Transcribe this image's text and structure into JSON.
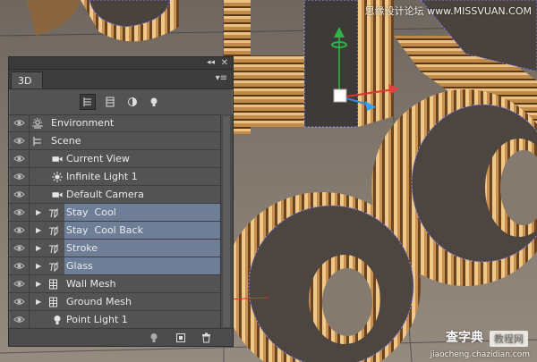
{
  "watermark": {
    "top_right": "思缘设计论坛  www.MISSVUAN.COM",
    "logo": "查字典",
    "badge": "教程网",
    "url": "jiaocheng.chazidian.com"
  },
  "panel": {
    "tab_label": "3D",
    "filters": [
      "whole-scene-icon",
      "meshes-icon",
      "materials-icon",
      "lights-icon"
    ],
    "layers": [
      {
        "label": "Environment",
        "icon": "environment-icon",
        "indent": 0,
        "expand": false,
        "selected": false,
        "visible": true
      },
      {
        "label": "Scene",
        "icon": "scene-icon",
        "indent": 0,
        "expand": false,
        "selected": false,
        "visible": true
      },
      {
        "label": "Current View",
        "icon": "camera-icon",
        "indent": 1,
        "expand": false,
        "selected": false,
        "visible": true
      },
      {
        "label": "Infinite Light 1",
        "icon": "infinite-light-icon",
        "indent": 1,
        "expand": false,
        "selected": false,
        "visible": true
      },
      {
        "label": "Default Camera",
        "icon": "camera-icon",
        "indent": 1,
        "expand": false,
        "selected": false,
        "visible": true
      },
      {
        "label": "Stay  Cool",
        "icon": "text-mesh-icon",
        "indent": 1,
        "expand": true,
        "selected": true,
        "visible": true
      },
      {
        "label": "Stay  Cool Back",
        "icon": "text-mesh-icon",
        "indent": 1,
        "expand": true,
        "selected": true,
        "visible": true
      },
      {
        "label": "Stroke",
        "icon": "text-mesh-icon",
        "indent": 1,
        "expand": true,
        "selected": true,
        "visible": true
      },
      {
        "label": "Glass",
        "icon": "text-mesh-icon",
        "indent": 1,
        "expand": true,
        "selected": true,
        "visible": true
      },
      {
        "label": "Wall Mesh",
        "icon": "mesh-icon",
        "indent": 1,
        "expand": true,
        "selected": false,
        "visible": true
      },
      {
        "label": "Ground Mesh",
        "icon": "mesh-icon",
        "indent": 1,
        "expand": true,
        "selected": false,
        "visible": true
      },
      {
        "label": "Point Light 1",
        "icon": "point-light-icon",
        "indent": 1,
        "expand": false,
        "selected": false,
        "visible": true
      }
    ],
    "footer_icons": [
      "light-bulb-icon",
      "new-object-icon",
      "trash-icon"
    ]
  },
  "colors": {
    "panel_bg": "#535353",
    "selection": "#6d7e96",
    "wood_light": "#d9a66a",
    "wood_dark": "#6b4524"
  }
}
